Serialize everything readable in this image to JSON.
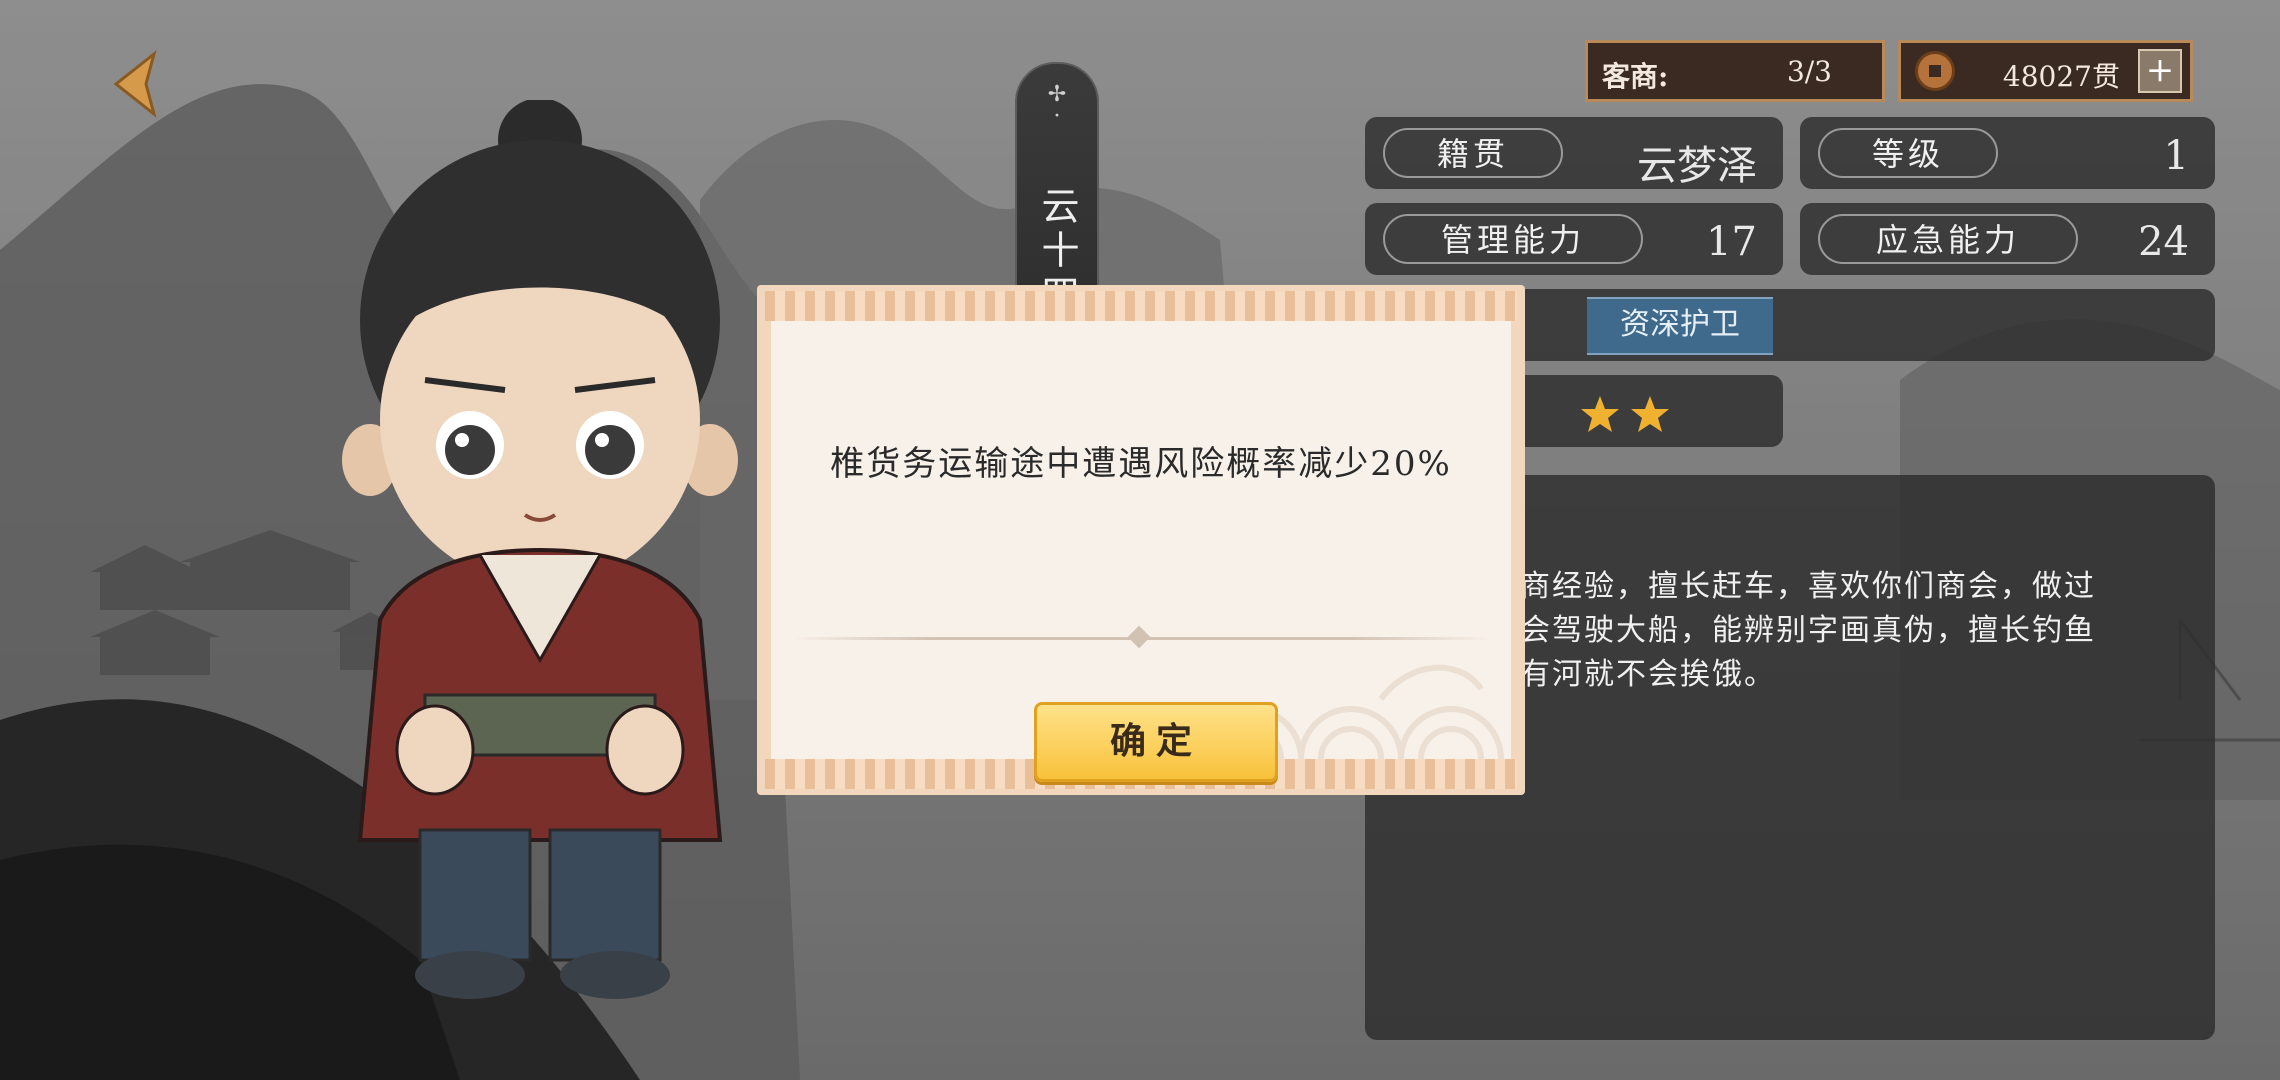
{
  "character": {
    "name": "云十四",
    "dots": "·\n·\n·"
  },
  "top_bar": {
    "merchant_label": "客商:",
    "merchant_value": "3/3",
    "money_value": "48027贯",
    "plus_label": "+"
  },
  "info": {
    "origin_label": "籍贯",
    "origin_value": "云梦泽",
    "level_label": "等级",
    "level_value": "1",
    "management_label": "管理能力",
    "management_value": "17",
    "emergency_label": "应急能力",
    "emergency_value": "24",
    "title_tag": "资深护卫",
    "rating_stars": 2,
    "description_lines": [
      "商经验，擅长赶车，喜欢你们商会，做过",
      "会驾驶大船，能辨别字画真伪，擅长钓鱼",
      "有河就不会挨饿。"
    ]
  },
  "dialog": {
    "message": "椎货务运输途中遭遇风险概率减少20%",
    "confirm_label": "确定"
  },
  "colors": {
    "accent_gold": "#f8c23a",
    "tag_blue": "#3f6a8c",
    "star": "#f0b030",
    "back_arrow": "#d59a4a"
  },
  "icons": [
    "back-arrow-icon",
    "coin-icon",
    "plus-icon",
    "star-icon"
  ]
}
